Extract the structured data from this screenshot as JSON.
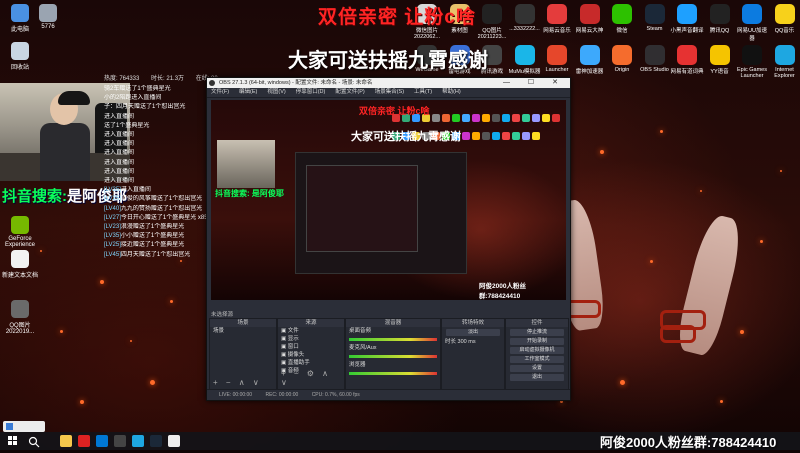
{
  "overlays": {
    "red_banner": "双倍亲密 让粉c啥",
    "white_banner": "大家可送扶摇九霄感谢",
    "bottom_fan_group": "阿俊2000人粉丝群:788424410",
    "douyin_prefix": "抖音搜索:",
    "douyin_name": "是阿俊耶"
  },
  "stream_stats": {
    "viewers": "热度: 764333",
    "duration": "时长: 21.3万",
    "gifts": "在线: 80"
  },
  "desktop_icons_left": [
    {
      "label": "此电脑",
      "icon": "computer-icon",
      "color": "#4a90e2"
    },
    {
      "label": "5776",
      "icon": "file-icon",
      "color": "#9aa4b1"
    },
    {
      "label": "回收站",
      "icon": "recycle-bin-icon",
      "color": "#c9d6e3"
    },
    {
      "label": "GeForce Experience",
      "icon": "geforce-icon",
      "color": "#76b900"
    },
    {
      "label": "新建文本文档",
      "icon": "text-file-icon",
      "color": "#f2f2f2"
    },
    {
      "label": "QQ图片 2022019...",
      "icon": "image-file-icon",
      "color": "#6a6a6a"
    }
  ],
  "desktop_icons_top": [
    {
      "label": "微信图片 2022062...",
      "icon": "image-file-icon",
      "color": "#d8d8d8"
    },
    {
      "label": "素材图",
      "icon": "folder-icon",
      "color": "#e8c16a"
    },
    {
      "label": "QQ图片 20211223...",
      "icon": "image-file-icon",
      "color": "#222"
    },
    {
      "label": "...3332222...",
      "icon": "image-file-icon",
      "color": "#333"
    },
    {
      "label": "网易云音乐",
      "icon": "netease-music-icon",
      "color": "#e43c3c"
    },
    {
      "label": "网易云大神",
      "icon": "netease-dashen-icon",
      "color": "#c72a2a"
    },
    {
      "label": "微信",
      "icon": "wechat-icon",
      "color": "#2dc100"
    },
    {
      "label": "Steam",
      "icon": "steam-icon",
      "color": "#1b2838"
    },
    {
      "label": "小黑声音翻译",
      "icon": "voice-icon",
      "color": "#1ea0ff"
    },
    {
      "label": "腾讯QQ",
      "icon": "qq-icon",
      "color": "#222"
    },
    {
      "label": "网易UU加速器",
      "icon": "uu-icon",
      "color": "#0c7be0"
    },
    {
      "label": "QQ音乐",
      "icon": "qq-music-icon",
      "color": "#f7d11b"
    }
  ],
  "desktop_icons_row2": [
    {
      "label": "WeGame",
      "icon": "wegame-icon",
      "color": "#333"
    },
    {
      "label": "雷电游戏",
      "icon": "game-icon",
      "color": "#3a6fd8"
    },
    {
      "label": "腾讯游戏",
      "icon": "game-icon",
      "color": "#444"
    },
    {
      "label": "MuMu模拟器",
      "icon": "mumu-icon",
      "color": "#1ab6e8"
    },
    {
      "label": "Launcher",
      "icon": "launcher-icon",
      "color": "#e6472b"
    },
    {
      "label": "雷神加速器",
      "icon": "thunder-icon",
      "color": "#3da9fc"
    },
    {
      "label": "Origin",
      "icon": "origin-icon",
      "color": "#f56c2d"
    },
    {
      "label": "OBS Studio",
      "icon": "obs-icon",
      "color": "#302e31"
    },
    {
      "label": "网易有道词典",
      "icon": "youdao-icon",
      "color": "#e63232"
    },
    {
      "label": "YY语音",
      "icon": "yy-icon",
      "color": "#f5c400"
    },
    {
      "label": "Epic Games Launcher",
      "icon": "epic-icon",
      "color": "#111"
    },
    {
      "label": "Internet Explorer",
      "icon": "ie-icon",
      "color": "#1ea7e1"
    }
  ],
  "chat": [
    {
      "lv": "",
      "text": "骑2车赠送了1个盛典星光"
    },
    {
      "lv": "",
      "text": "小的2陪跑进入直播间"
    },
    {
      "lv": "",
      "text": "子：四月天赠送了1个怼出宫光"
    },
    {
      "lv": "",
      "text": "进入直播间"
    },
    {
      "lv": "",
      "text": "送了1个盛典星光"
    },
    {
      "lv": "",
      "text": "进入直播间"
    },
    {
      "lv": "",
      "text": "进入直播间"
    },
    {
      "lv": "",
      "text": "进入直播间"
    },
    {
      "lv": "",
      "text": "进入直播间"
    },
    {
      "lv": "",
      "text": "进入直播间"
    },
    {
      "lv": "",
      "text": "进入直播间"
    },
    {
      "lv": "[LV35]",
      "text": "进入直播间"
    },
    {
      "lv": "[LV25]",
      "text": "阿俊的风筝赠送了1个怼出宫光"
    },
    {
      "lv": "[LV40]",
      "text": "九九的赞扬赠送了1个怼出宫光"
    },
    {
      "lv": "[LV27]",
      "text": "今日开心赠送了1个盛典星光 x85"
    },
    {
      "lv": "[LV23]",
      "text": "浪漫赠送了1个盛典星光"
    },
    {
      "lv": "[LV35]",
      "text": "小小赠送了1个盛典星光"
    },
    {
      "lv": "[LV25]",
      "text": "接近赠送了1个盛典星光"
    },
    {
      "lv": "[LV45]",
      "text": "四月天赠送了1个怼出宫光"
    }
  ],
  "obs": {
    "title": "OBS 27.1.3 (64-bit, windows) - 配置文件: 未命名 - 场景: 未命名",
    "window_controls": "— ☐ ✕",
    "menu": [
      "文件(F)",
      "编辑(E)",
      "视图(V)",
      "停靠窗口(D)",
      "配置文件(P)",
      "场景集合(S)",
      "工具(T)",
      "帮助(H)"
    ],
    "preview_title": "大家可送扶摇九霄感谢",
    "preview_red": "双倍亲密 让粉c啥",
    "preview_douyin": "抖音搜索: 是阿俊耶",
    "preview_footer": "阿俊2000人粉丝群:788424410",
    "scene_label": "未选择源",
    "docks": {
      "scenes": {
        "header": "场景",
        "items": [
          "场景"
        ]
      },
      "sources": {
        "header": "来源",
        "items": [
          "文件",
          "显示",
          "窗口",
          "摄像头",
          "直播助手",
          "音频"
        ]
      },
      "mixer": {
        "header": "混音器",
        "items": [
          "桌面音频",
          "麦克风/Aux",
          "浏览器"
        ]
      },
      "transitions": {
        "header": "转场特效",
        "type": "淡出",
        "duration_label": "时长",
        "duration": "300 ms"
      },
      "controls": {
        "header": "控件",
        "buttons": [
          "停止推流",
          "开始录制",
          "启动虚拟摄像机",
          "工作室模式",
          "设置",
          "退出"
        ]
      }
    },
    "status": {
      "live": "LIVE: 00:00:00",
      "rec": "REC: 00:00:00",
      "cpu": "CPU: 0.7%, 60.00 fps"
    }
  },
  "taskbar": {
    "items": [
      {
        "icon": "explorer-icon",
        "color": "#f5c84c"
      },
      {
        "icon": "app-icon",
        "color": "#d22"
      },
      {
        "icon": "store-icon",
        "color": "#0078d4"
      },
      {
        "icon": "obs-icon",
        "color": "#444"
      },
      {
        "icon": "edge-icon",
        "color": "#1ea7e1"
      },
      {
        "icon": "steam-icon",
        "color": "#1b2838"
      },
      {
        "icon": "chrome-icon",
        "color": "#eee"
      }
    ]
  }
}
